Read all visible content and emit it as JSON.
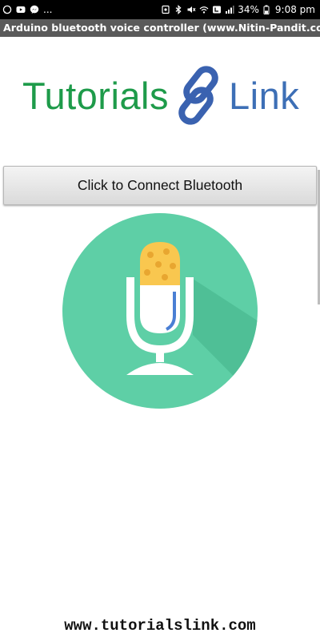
{
  "status_bar": {
    "left_icons": [
      "whatsapp-icon",
      "youtube-icon",
      "messenger-icon"
    ],
    "more": "...",
    "battery_percent": "34%",
    "time": "9:08 pm",
    "right_icons": [
      "notification-icon",
      "bluetooth-icon",
      "mute-icon",
      "wifi-icon",
      "lte-badge-icon",
      "signal-icon",
      "battery-icon"
    ]
  },
  "title_bar": {
    "title": "Arduino bluetooth voice controller (www.Nitin-Pandit.co..."
  },
  "logo": {
    "word_left": "Tutorials",
    "word_right": "Link",
    "left_color": "#1e9b4a",
    "right_color": "#3d6fb6"
  },
  "connect_button": {
    "label": "Click to Connect Bluetooth"
  },
  "mic_button": {
    "icon": "microphone-icon",
    "circle_color": "#5ecfa6",
    "capsule_color": "#f9c74f"
  },
  "footer": {
    "url": "www.tutorialslink.com"
  }
}
